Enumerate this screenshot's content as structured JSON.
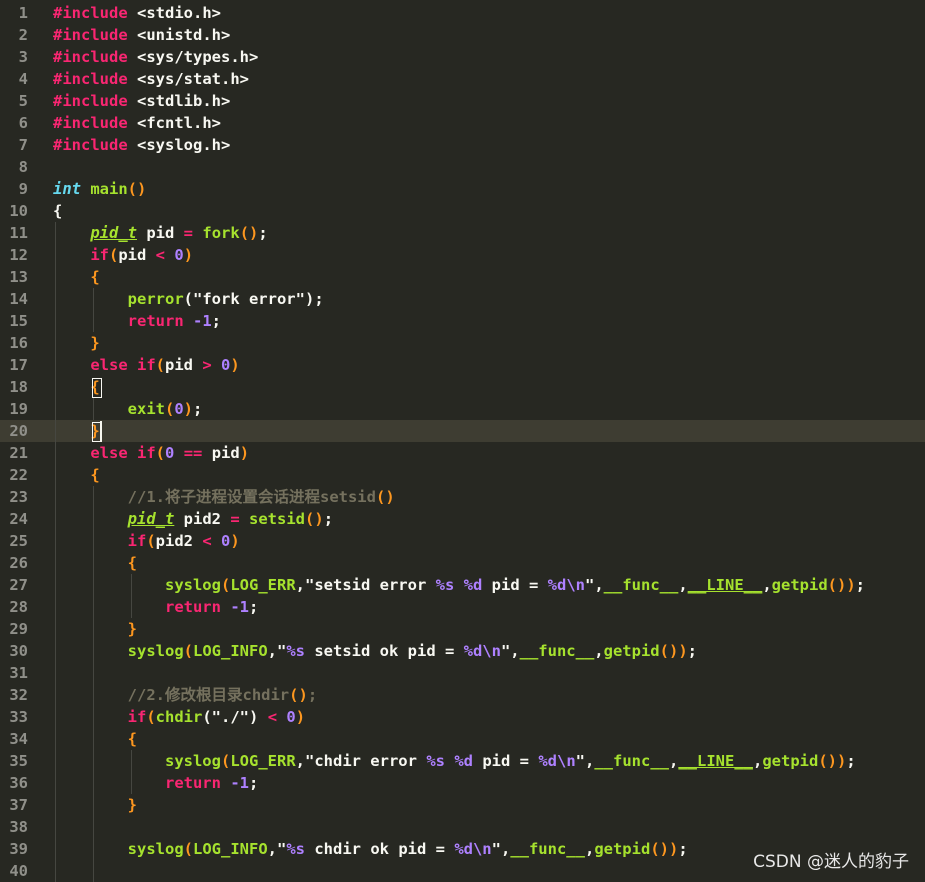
{
  "colors": {
    "background": "#272822",
    "keyword": "#f92672",
    "type": "#66d9ef",
    "function": "#a6e22e",
    "string": "#e6db74",
    "number": "#ae81ff",
    "comment": "#75715e",
    "text": "#f8f8f2",
    "paren": "#fd971f",
    "gutter": "#90908a"
  },
  "editor": {
    "active_line": 20,
    "lines": [
      {
        "n": "1",
        "segs": [
          [
            "#include",
            "k"
          ],
          [
            " ",
            "t"
          ],
          [
            "<stdio.h>",
            "t"
          ]
        ]
      },
      {
        "n": "2",
        "segs": [
          [
            "#include",
            "k"
          ],
          [
            " ",
            "t"
          ],
          [
            "<unistd.h>",
            "t"
          ]
        ]
      },
      {
        "n": "3",
        "segs": [
          [
            "#include",
            "k"
          ],
          [
            " ",
            "t"
          ],
          [
            "<sys/types.h>",
            "t"
          ]
        ]
      },
      {
        "n": "4",
        "segs": [
          [
            "#include",
            "k"
          ],
          [
            " ",
            "t"
          ],
          [
            "<sys/stat.h>",
            "t"
          ]
        ]
      },
      {
        "n": "5",
        "segs": [
          [
            "#include",
            "k"
          ],
          [
            " ",
            "t"
          ],
          [
            "<stdlib.h>",
            "t"
          ]
        ]
      },
      {
        "n": "6",
        "segs": [
          [
            "#include",
            "k"
          ],
          [
            " ",
            "t"
          ],
          [
            "<fcntl.h>",
            "t"
          ]
        ]
      },
      {
        "n": "7",
        "segs": [
          [
            "#include",
            "k"
          ],
          [
            " ",
            "t"
          ],
          [
            "<syslog.h>",
            "t"
          ]
        ]
      },
      {
        "n": "8",
        "segs": []
      },
      {
        "n": "9",
        "segs": [
          [
            "int",
            "ti"
          ],
          [
            " ",
            "t"
          ],
          [
            "main",
            "f"
          ],
          [
            "()",
            "p"
          ]
        ]
      },
      {
        "n": "10",
        "segs": [
          [
            "{",
            "t"
          ]
        ]
      },
      {
        "n": "11",
        "segs": [
          [
            "    ",
            "t"
          ],
          [
            "pid_t",
            "tu"
          ],
          [
            " pid ",
            "t"
          ],
          [
            "=",
            "k"
          ],
          [
            " ",
            "t"
          ],
          [
            "fork",
            "f"
          ],
          [
            "()",
            "p"
          ],
          [
            ";",
            "t"
          ]
        ]
      },
      {
        "n": "12",
        "segs": [
          [
            "    ",
            "t"
          ],
          [
            "if",
            "k"
          ],
          [
            "(",
            "p"
          ],
          [
            "pid ",
            "t"
          ],
          [
            "<",
            "k"
          ],
          [
            " ",
            "t"
          ],
          [
            "0",
            "n"
          ],
          [
            ")",
            "p"
          ]
        ]
      },
      {
        "n": "13",
        "segs": [
          [
            "    ",
            "t"
          ],
          [
            "{",
            "p"
          ]
        ]
      },
      {
        "n": "14",
        "segs": [
          [
            "        ",
            "t"
          ],
          [
            "perror",
            "f"
          ],
          [
            "(\"fork error\")",
            "t"
          ],
          [
            ";",
            "t"
          ]
        ]
      },
      {
        "n": "15",
        "segs": [
          [
            "        ",
            "t"
          ],
          [
            "return",
            "k"
          ],
          [
            " ",
            "t"
          ],
          [
            "-1",
            "n"
          ],
          [
            ";",
            "t"
          ]
        ]
      },
      {
        "n": "16",
        "segs": [
          [
            "    ",
            "t"
          ],
          [
            "}",
            "p"
          ]
        ]
      },
      {
        "n": "17",
        "segs": [
          [
            "    ",
            "t"
          ],
          [
            "else",
            "k"
          ],
          [
            " ",
            "t"
          ],
          [
            "if",
            "k"
          ],
          [
            "(",
            "p"
          ],
          [
            "pid ",
            "t"
          ],
          [
            ">",
            "k"
          ],
          [
            " ",
            "t"
          ],
          [
            "0",
            "n"
          ],
          [
            ")",
            "p"
          ]
        ]
      },
      {
        "n": "18",
        "segs": [
          [
            "    ",
            "t"
          ],
          [
            "{",
            "p"
          ]
        ]
      },
      {
        "n": "19",
        "segs": [
          [
            "        ",
            "t"
          ],
          [
            "exit",
            "f"
          ],
          [
            "(",
            "p"
          ],
          [
            "0",
            "n"
          ],
          [
            ")",
            "p"
          ],
          [
            ";",
            "t"
          ]
        ]
      },
      {
        "n": "20",
        "segs": [
          [
            "    ",
            "t"
          ],
          [
            "}",
            "p"
          ]
        ]
      },
      {
        "n": "21",
        "segs": [
          [
            "    ",
            "t"
          ],
          [
            "else",
            "k"
          ],
          [
            " ",
            "t"
          ],
          [
            "if",
            "k"
          ],
          [
            "(",
            "p"
          ],
          [
            "0",
            "n"
          ],
          [
            " ",
            "t"
          ],
          [
            "==",
            "k"
          ],
          [
            " pid",
            "t"
          ],
          [
            ")",
            "p"
          ]
        ]
      },
      {
        "n": "22",
        "segs": [
          [
            "    ",
            "t"
          ],
          [
            "{",
            "p"
          ]
        ]
      },
      {
        "n": "23",
        "segs": [
          [
            "        ",
            "t"
          ],
          [
            "//1.将子进程设置会话进程setsid",
            "c"
          ],
          [
            "()",
            "p"
          ]
        ]
      },
      {
        "n": "24",
        "segs": [
          [
            "        ",
            "t"
          ],
          [
            "pid_t",
            "tu"
          ],
          [
            " pid2 ",
            "t"
          ],
          [
            "=",
            "k"
          ],
          [
            " ",
            "t"
          ],
          [
            "setsid",
            "f"
          ],
          [
            "()",
            "p"
          ],
          [
            ";",
            "t"
          ]
        ]
      },
      {
        "n": "25",
        "segs": [
          [
            "        ",
            "t"
          ],
          [
            "if",
            "k"
          ],
          [
            "(",
            "p"
          ],
          [
            "pid2 ",
            "t"
          ],
          [
            "<",
            "k"
          ],
          [
            " ",
            "t"
          ],
          [
            "0",
            "n"
          ],
          [
            ")",
            "p"
          ]
        ]
      },
      {
        "n": "26",
        "segs": [
          [
            "        ",
            "t"
          ],
          [
            "{",
            "p"
          ]
        ]
      },
      {
        "n": "27",
        "segs": [
          [
            "            ",
            "t"
          ],
          [
            "syslog",
            "f"
          ],
          [
            "(",
            "p"
          ],
          [
            "LOG_ERR",
            "f"
          ],
          [
            ",\"setsid error ",
            "t"
          ],
          [
            "%s",
            "n"
          ],
          [
            " ",
            "t"
          ],
          [
            "%d",
            "n"
          ],
          [
            " pid = ",
            "t"
          ],
          [
            "%d\\n",
            "n"
          ],
          [
            "\",",
            "t"
          ],
          [
            "__func__",
            "f"
          ],
          [
            ",",
            "t"
          ],
          [
            "__LINE__",
            "fu"
          ],
          [
            ",",
            "t"
          ],
          [
            "getpid",
            "f"
          ],
          [
            "()",
            "p"
          ],
          [
            ")",
            "p"
          ],
          [
            ";",
            "t"
          ]
        ]
      },
      {
        "n": "28",
        "segs": [
          [
            "            ",
            "t"
          ],
          [
            "return",
            "k"
          ],
          [
            " ",
            "t"
          ],
          [
            "-1",
            "n"
          ],
          [
            ";",
            "t"
          ]
        ]
      },
      {
        "n": "29",
        "segs": [
          [
            "        ",
            "t"
          ],
          [
            "}",
            "p"
          ]
        ]
      },
      {
        "n": "30",
        "segs": [
          [
            "        ",
            "t"
          ],
          [
            "syslog",
            "f"
          ],
          [
            "(",
            "p"
          ],
          [
            "LOG_INFO",
            "f"
          ],
          [
            ",\"",
            "t"
          ],
          [
            "%s",
            "n"
          ],
          [
            " setsid ok pid = ",
            "t"
          ],
          [
            "%d\\n",
            "n"
          ],
          [
            "\",",
            "t"
          ],
          [
            "__func__",
            "f"
          ],
          [
            ",",
            "t"
          ],
          [
            "getpid",
            "f"
          ],
          [
            "()",
            "p"
          ],
          [
            ")",
            "p"
          ],
          [
            ";",
            "t"
          ]
        ]
      },
      {
        "n": "31",
        "segs": []
      },
      {
        "n": "32",
        "segs": [
          [
            "        ",
            "t"
          ],
          [
            "//2.修改根目录chdir",
            "c"
          ],
          [
            "()",
            "p"
          ],
          [
            ";",
            "c"
          ]
        ]
      },
      {
        "n": "33",
        "segs": [
          [
            "        ",
            "t"
          ],
          [
            "if",
            "k"
          ],
          [
            "(",
            "p"
          ],
          [
            "chdir",
            "f"
          ],
          [
            "(\"./\")",
            "t"
          ],
          [
            " ",
            "t"
          ],
          [
            "<",
            "k"
          ],
          [
            " ",
            "t"
          ],
          [
            "0",
            "n"
          ],
          [
            ")",
            "p"
          ]
        ]
      },
      {
        "n": "34",
        "segs": [
          [
            "        ",
            "t"
          ],
          [
            "{",
            "p"
          ]
        ]
      },
      {
        "n": "35",
        "segs": [
          [
            "            ",
            "t"
          ],
          [
            "syslog",
            "f"
          ],
          [
            "(",
            "p"
          ],
          [
            "LOG_ERR",
            "f"
          ],
          [
            ",\"chdir error ",
            "t"
          ],
          [
            "%s",
            "n"
          ],
          [
            " ",
            "t"
          ],
          [
            "%d",
            "n"
          ],
          [
            " pid = ",
            "t"
          ],
          [
            "%d\\n",
            "n"
          ],
          [
            "\",",
            "t"
          ],
          [
            "__func__",
            "f"
          ],
          [
            ",",
            "t"
          ],
          [
            "__LINE__",
            "fu"
          ],
          [
            ",",
            "t"
          ],
          [
            "getpid",
            "f"
          ],
          [
            "()",
            "p"
          ],
          [
            ")",
            "p"
          ],
          [
            ";",
            "t"
          ]
        ]
      },
      {
        "n": "36",
        "segs": [
          [
            "            ",
            "t"
          ],
          [
            "return",
            "k"
          ],
          [
            " ",
            "t"
          ],
          [
            "-1",
            "n"
          ],
          [
            ";",
            "t"
          ]
        ]
      },
      {
        "n": "37",
        "segs": [
          [
            "        ",
            "t"
          ],
          [
            "}",
            "p"
          ]
        ]
      },
      {
        "n": "38",
        "segs": []
      },
      {
        "n": "39",
        "segs": [
          [
            "        ",
            "t"
          ],
          [
            "syslog",
            "f"
          ],
          [
            "(",
            "p"
          ],
          [
            "LOG_INFO",
            "f"
          ],
          [
            ",\"",
            "t"
          ],
          [
            "%s",
            "n"
          ],
          [
            " chdir ok pid = ",
            "t"
          ],
          [
            "%d\\n",
            "n"
          ],
          [
            "\",",
            "t"
          ],
          [
            "__func__",
            "f"
          ],
          [
            ",",
            "t"
          ],
          [
            "getpid",
            "f"
          ],
          [
            "()",
            "p"
          ],
          [
            ")",
            "p"
          ],
          [
            ";",
            "t"
          ]
        ]
      },
      {
        "n": "40",
        "segs": []
      }
    ]
  },
  "watermark": "CSDN @迷人的豹子"
}
